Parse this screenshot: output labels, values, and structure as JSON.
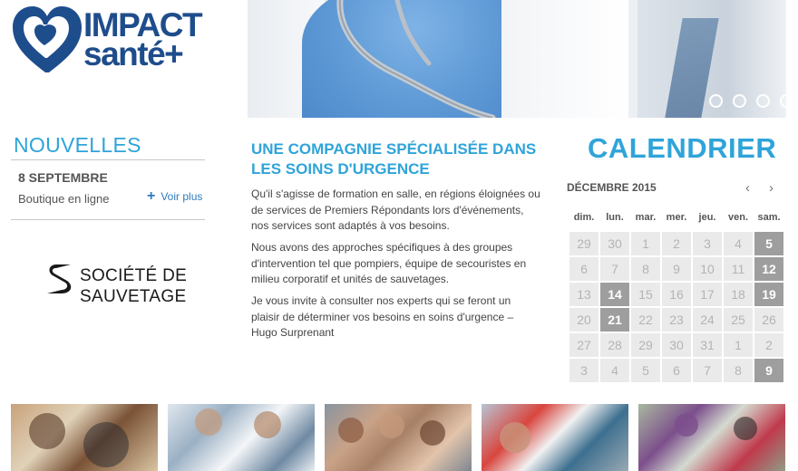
{
  "logo": {
    "line1": "IMPACT",
    "line2": "santé+",
    "color": "#1e4d8c"
  },
  "hero": {
    "slide_count": 5,
    "active_slide": 5
  },
  "news": {
    "title": "NOUVELLES",
    "date": "8 SEPTEMBRE",
    "item": "Boutique en ligne",
    "more_label": "Voir plus"
  },
  "sponsor": {
    "line1": "SOCIÉTÉ DE",
    "line2": "SAUVETAGE"
  },
  "article": {
    "title": "UNE COMPAGNIE SPÉCIALISÉE DANS LES SOINS D'URGENCE",
    "paragraphs": [
      "Qu'il s'agisse de formation en salle, en régions éloignées ou de services de Premiers Répondants lors d'événements, nos services sont adaptés à vos besoins.",
      "Nous avons des approches spécifiques à des groupes d'intervention tel que pompiers, équipe de secouristes en milieu corporatif et unités de sauvetages.",
      "Je vous invite à consulter nos experts qui se feront un plaisir de déterminer vos besoins en soins d'urgence – Hugo Surprenant"
    ]
  },
  "calendar": {
    "title": "CALENDRIER",
    "month": "DÉCEMBRE 2015",
    "prev_icon": "‹",
    "next_icon": "›",
    "weekdays": [
      "dim.",
      "lun.",
      "mar.",
      "mer.",
      "jeu.",
      "ven.",
      "sam."
    ],
    "weeks": [
      [
        29,
        30,
        1,
        2,
        3,
        4,
        5
      ],
      [
        6,
        7,
        8,
        9,
        10,
        11,
        12
      ],
      [
        13,
        14,
        15,
        16,
        17,
        18,
        19
      ],
      [
        20,
        21,
        22,
        23,
        24,
        25,
        26
      ],
      [
        27,
        28,
        29,
        30,
        31,
        1,
        2
      ],
      [
        3,
        4,
        5,
        6,
        7,
        8,
        9
      ]
    ],
    "highlighted": [
      [
        0,
        6
      ],
      [
        1,
        6
      ],
      [
        2,
        1
      ],
      [
        2,
        6
      ],
      [
        3,
        1
      ],
      [
        5,
        6
      ]
    ]
  },
  "thumbnails": [
    "group-photo",
    "medical-team-photo",
    "crowd-photo",
    "rescue-photo",
    "hikers-photo"
  ],
  "colors": {
    "accent": "#2fa4d9",
    "link": "#2d7bbd",
    "highlight": "#9e9e9e",
    "cell": "#eaeaea"
  }
}
